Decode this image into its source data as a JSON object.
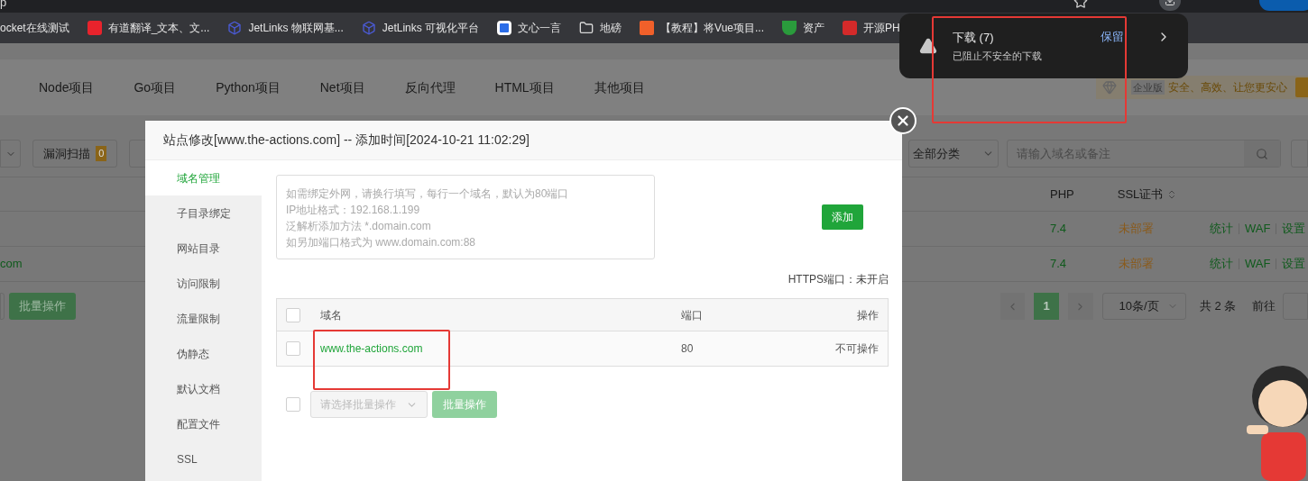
{
  "browser": {
    "url_fragment": "p",
    "bookmarks": [
      {
        "label": "ocket在线测试"
      },
      {
        "label": "有道翻译_文本、文..."
      },
      {
        "label": "JetLinks 物联网基..."
      },
      {
        "label": "JetLinks 可视化平台"
      },
      {
        "label": "文心一言"
      },
      {
        "label": "地磅"
      },
      {
        "label": "【教程】将Vue项目..."
      },
      {
        "label": "资产"
      },
      {
        "label": "开源PH"
      }
    ]
  },
  "download_popup": {
    "title": "下载 (7)",
    "subtitle": "已阻止不安全的下载",
    "action": "保留"
  },
  "nav_tabs": [
    {
      "label": "Node项目",
      "selected": false
    },
    {
      "label": "Go项目",
      "selected": false
    },
    {
      "label": "Python项目",
      "selected": false
    },
    {
      "label": "Net项目",
      "selected": false
    },
    {
      "label": "反向代理",
      "selected": false
    },
    {
      "label": "HTML项目",
      "selected": false
    },
    {
      "label": "其他项目",
      "selected": false
    }
  ],
  "promo": {
    "badge": "企业版",
    "text": "安全、高效、让您更安心"
  },
  "toolbar": {
    "scan_button": "漏洞扫描",
    "scan_count": "0",
    "category_select": "全部分类",
    "search_placeholder": "请输入域名或备注"
  },
  "site_table": {
    "columns": [
      "PHP",
      "SSL证书"
    ],
    "rows": [
      {
        "name": "",
        "php": "7.4",
        "ssl": "未部署",
        "actions": [
          "统计",
          "WAF",
          "设置"
        ]
      },
      {
        "name": "com",
        "php": "7.4",
        "ssl": "未部署",
        "actions": [
          "统计",
          "WAF",
          "设置"
        ]
      }
    ]
  },
  "footer": {
    "batch_button": "批量操作",
    "pages": [
      {
        "label": "1",
        "selected": true
      }
    ],
    "page_size": "10条/页",
    "total": "共 2 条",
    "goto": "前往"
  },
  "dialog": {
    "title": "站点修改[www.the-actions.com] -- 添加时间[2024-10-21 11:02:29]",
    "menu": [
      {
        "label": "域名管理",
        "selected": true
      },
      {
        "label": "子目录绑定",
        "selected": false
      },
      {
        "label": "网站目录",
        "selected": false
      },
      {
        "label": "访问限制",
        "selected": false
      },
      {
        "label": "流量限制",
        "selected": false
      },
      {
        "label": "伪静态",
        "selected": false
      },
      {
        "label": "默认文档",
        "selected": false
      },
      {
        "label": "配置文件",
        "selected": false
      },
      {
        "label": "SSL",
        "selected": false
      }
    ],
    "domain_input": {
      "placeholder_lines": [
        "如需绑定外网，请换行填写，每行一个域名，默认为80端口",
        "IP地址格式：192.168.1.199",
        "泛解析添加方法 *.domain.com",
        "如另加端口格式为 www.domain.com:88"
      ]
    },
    "add_button": "添加",
    "https_port": "HTTPS端口：未开启",
    "table": {
      "columns": [
        "域名",
        "端口",
        "操作"
      ],
      "header_checked": false,
      "rows": [
        {
          "domain": "www.the-actions.com",
          "port": "80",
          "action": "不可操作",
          "checked": false
        }
      ]
    },
    "batch": {
      "checked": false,
      "select_placeholder": "请选择批量操作",
      "button": "批量操作",
      "disabled": true
    }
  }
}
